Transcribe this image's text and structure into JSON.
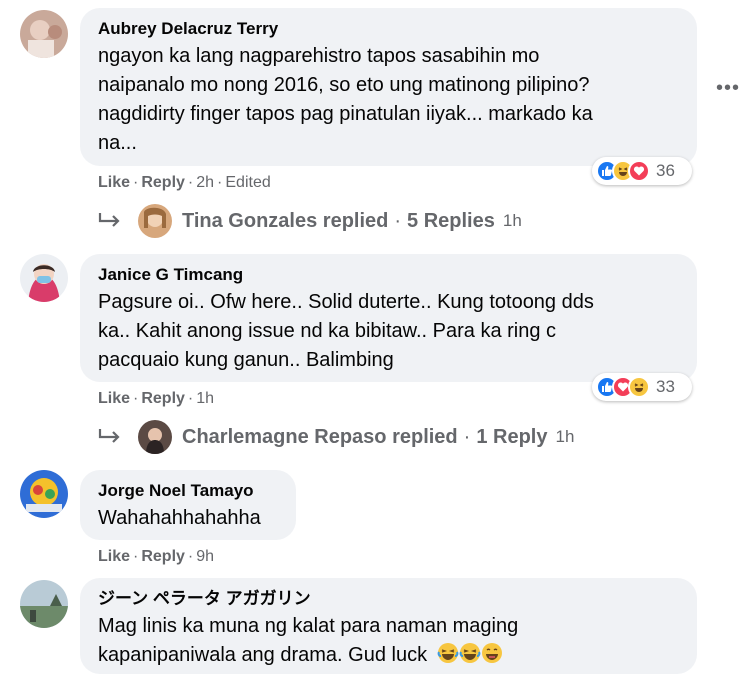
{
  "comments": [
    {
      "author": "Aubrey Delacruz Terry",
      "text_lines": [
        "ngayon ka lang nagparehistro tapos sasabihin mo",
        "naipanalo mo nong 2016, so eto ung matinong pilipino?",
        "nagdidirty finger tapos pag pinatulan iiyak... markado ka",
        "na..."
      ],
      "like": "Like",
      "reply": "Reply",
      "time": "2h",
      "edited": "Edited",
      "reaction_icons": [
        "like-icon",
        "haha-icon",
        "love-icon"
      ],
      "reaction_count": "36",
      "replies": {
        "name": "Tina Gonzales replied",
        "count": "5 Replies",
        "time": "1h"
      }
    },
    {
      "author": "Janice G Timcang",
      "text_lines": [
        "Pagsure oi.. Ofw here.. Solid duterte.. Kung totoong dds",
        "ka.. Kahit anong issue nd ka bibitaw.. Para ka ring c",
        "pacquaio kung ganun.. Balimbing"
      ],
      "like": "Like",
      "reply": "Reply",
      "time": "1h",
      "reaction_icons": [
        "like-icon",
        "love-icon",
        "haha-icon"
      ],
      "reaction_count": "33",
      "replies": {
        "name": "Charlemagne Repaso replied",
        "count": "1 Reply",
        "time": "1h"
      }
    },
    {
      "author": "Jorge Noel Tamayo",
      "text_lines": [
        "Wahahahhahahha"
      ],
      "like": "Like",
      "reply": "Reply",
      "time": "9h"
    },
    {
      "author": "ジーン ペラータ アガガリン",
      "text_lines": [
        "Mag linis ka muna ng kalat para naman maging",
        "kapanipaniwala ang drama. Gud luck"
      ],
      "emoji_icons": [
        "laughing-crying-emoji-icon",
        "laughing-crying-emoji-icon",
        "laughing-emoji-icon"
      ]
    }
  ],
  "more_menu": "•••",
  "separator": "·"
}
